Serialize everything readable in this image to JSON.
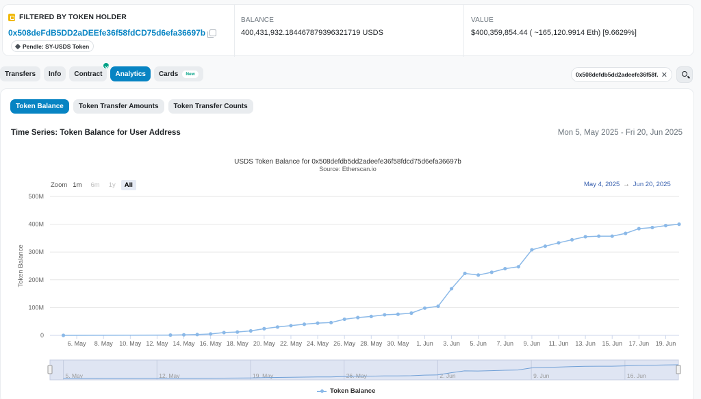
{
  "holder": {
    "title": "FILTERED BY TOKEN HOLDER",
    "address": "0x508deFdB5DD2aDEEfe36f58fdCD75d6efa36697b",
    "tag": "Pendle: SY-USDS Token"
  },
  "balance": {
    "label": "BALANCE",
    "value": "400,431,932.184467879396321719 USDS"
  },
  "value": {
    "label": "VALUE",
    "value": "$400,359,854.44 ( ~165,120.9914 Eth) [9.6629%]"
  },
  "tabs": [
    {
      "label": "Transfers"
    },
    {
      "label": "Info"
    },
    {
      "label": "Contract"
    },
    {
      "label": "Analytics"
    },
    {
      "label": "Cards",
      "badge": "New"
    }
  ],
  "filter": {
    "text": "0x508defdb5dd2adeefe36f58f..."
  },
  "subtabs": [
    "Token Balance",
    "Token Transfer Amounts",
    "Token Transfer Counts"
  ],
  "section": {
    "title": "Time Series: Token Balance for User Address",
    "range": "Mon 5, May 2025 - Fri 20, Jun 2025"
  },
  "chart_header": {
    "title": "USDS Token Balance for 0x508defdb5dd2adeefe36f58fdcd75d6efa36697b",
    "source": "Source: Etherscan.io"
  },
  "zoom": {
    "label": "Zoom",
    "buttons": [
      "1m",
      "6m",
      "1y",
      "All"
    ],
    "selected": "All"
  },
  "range_selector": {
    "from": "May 4, 2025",
    "arrow": "→",
    "to": "Jun 20, 2025"
  },
  "legend": {
    "label": "Token Balance"
  },
  "colors": {
    "accent": "#0784c3",
    "series": "#8bb9e8",
    "navigator_bg": "#dfe5f3"
  },
  "chart_data": {
    "type": "line",
    "ylabel": "Token Balance",
    "yticks": [
      "0",
      "100M",
      "200M",
      "300M",
      "400M",
      "500M"
    ],
    "ylim": [
      0,
      500
    ],
    "xticks": [
      "6. May",
      "8. May",
      "10. May",
      "12. May",
      "14. May",
      "16. May",
      "18. May",
      "20. May",
      "22. May",
      "24. May",
      "26. May",
      "28. May",
      "30. May",
      "1. Jun",
      "3. Jun",
      "5. Jun",
      "7. Jun",
      "9. Jun",
      "11. Jun",
      "13. Jun",
      "15. Jun",
      "17. Jun",
      "19. Jun"
    ],
    "navigator_labels": [
      "5. May",
      "12. May",
      "19. May",
      "26. May",
      "2. Jun",
      "9. Jun",
      "16. Jun"
    ],
    "grid": true,
    "legend_position": "bottom",
    "series": [
      {
        "name": "Token Balance",
        "unit": "M",
        "points": [
          [
            "2025-05-05",
            0
          ],
          [
            "2025-05-13",
            1
          ],
          [
            "2025-05-14",
            2
          ],
          [
            "2025-05-15",
            3
          ],
          [
            "2025-05-16",
            5
          ],
          [
            "2025-05-17",
            10
          ],
          [
            "2025-05-18",
            12
          ],
          [
            "2025-05-19",
            16
          ],
          [
            "2025-05-20",
            24
          ],
          [
            "2025-05-21",
            30
          ],
          [
            "2025-05-22",
            35
          ],
          [
            "2025-05-23",
            40
          ],
          [
            "2025-05-24",
            44
          ],
          [
            "2025-05-25",
            46
          ],
          [
            "2025-05-26",
            58
          ],
          [
            "2025-05-27",
            64
          ],
          [
            "2025-05-28",
            68
          ],
          [
            "2025-05-29",
            74
          ],
          [
            "2025-05-30",
            76
          ],
          [
            "2025-05-31",
            80
          ],
          [
            "2025-06-01",
            98
          ],
          [
            "2025-06-02",
            105
          ],
          [
            "2025-06-03",
            168
          ],
          [
            "2025-06-04",
            223
          ],
          [
            "2025-06-05",
            217
          ],
          [
            "2025-06-06",
            227
          ],
          [
            "2025-06-07",
            240
          ],
          [
            "2025-06-08",
            247
          ],
          [
            "2025-06-09",
            308
          ],
          [
            "2025-06-10",
            321
          ],
          [
            "2025-06-11",
            333
          ],
          [
            "2025-06-12",
            344
          ],
          [
            "2025-06-13",
            355
          ],
          [
            "2025-06-14",
            357
          ],
          [
            "2025-06-15",
            357
          ],
          [
            "2025-06-16",
            367
          ],
          [
            "2025-06-17",
            384
          ],
          [
            "2025-06-18",
            388
          ],
          [
            "2025-06-19",
            395
          ],
          [
            "2025-06-20",
            400
          ]
        ]
      }
    ]
  }
}
